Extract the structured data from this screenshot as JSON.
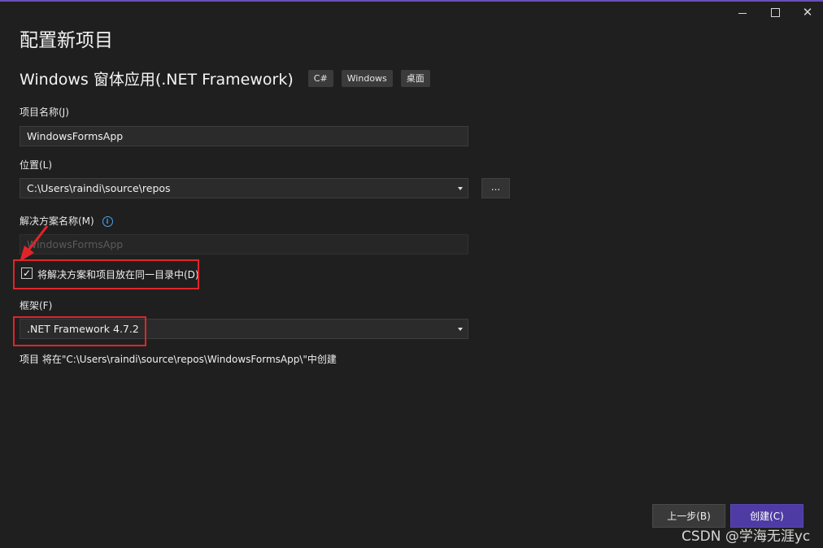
{
  "window": {
    "minimize_icon": "minimize-icon",
    "maximize_icon": "maximize-icon",
    "close_glyph": "✕"
  },
  "page_title": "配置新项目",
  "template": {
    "name": "Windows 窗体应用(.NET Framework)",
    "tags": [
      "C#",
      "Windows",
      "桌面"
    ]
  },
  "project_name": {
    "label": "项目名称(J)",
    "value": "WindowsFormsApp"
  },
  "location": {
    "label": "位置(L)",
    "value": "C:\\Users\\raindi\\source\\repos",
    "browse_label": "..."
  },
  "solution_name": {
    "label": "解决方案名称(M)",
    "info_glyph": "i",
    "value": "WindowsFormsApp",
    "disabled": true
  },
  "same_directory": {
    "checked": true,
    "check_glyph": "✓",
    "label": "将解决方案和项目放在同一目录中(D)"
  },
  "framework": {
    "label": "框架(F)",
    "value": ".NET Framework 4.7.2"
  },
  "summary": "项目 将在\"C:\\Users\\raindi\\source\\repos\\WindowsFormsApp\\\"中创建",
  "buttons": {
    "back": "上一步(B)",
    "create": "创建(C)"
  },
  "watermark": "CSDN @学海无涯yc",
  "colors": {
    "background": "#1f1f1f",
    "accent": "#4e3ba3",
    "annotation_red": "#e0252a"
  }
}
